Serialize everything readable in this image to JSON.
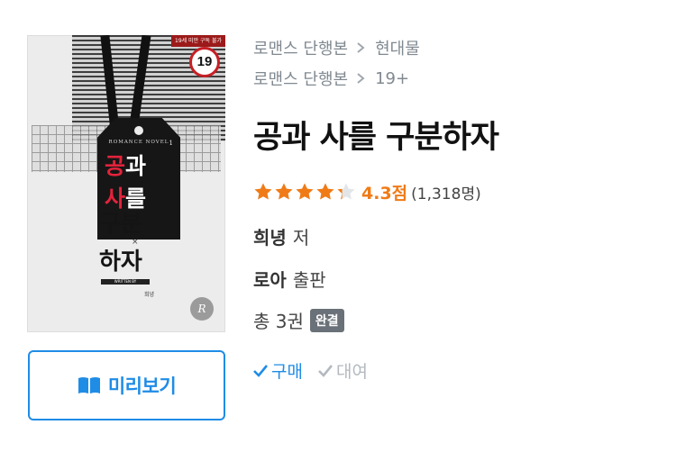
{
  "cover": {
    "age_banner": "19세 미만 구독 불가",
    "age_badge": "19",
    "tag_subtitle": "ROMANCE NOVEL",
    "tag_number": "1",
    "title_line1_a": "공",
    "title_line1_b": "과",
    "title_line2_a": "사",
    "title_line2_b": "를",
    "title_line3": "구분",
    "title_line4": "하자",
    "multiply": "×",
    "written_by": "WRITTEN BY",
    "author": "희녕"
  },
  "preview_button": {
    "label": "미리보기",
    "icon": "book-open-icon"
  },
  "breadcrumbs": [
    {
      "category": "로맨스 단행본",
      "sub": "현대물"
    },
    {
      "category": "로맨스 단행본",
      "sub": "19+"
    }
  ],
  "book": {
    "title": "공과 사를 구분하자"
  },
  "rating": {
    "score": "4.3점",
    "count": "(1,318명)",
    "stars_value": 4.3,
    "stars_max": 5
  },
  "author": {
    "name": "희녕",
    "role": "저"
  },
  "publisher": {
    "name": "로아",
    "role": "출판"
  },
  "volumes": {
    "text": "총 3권",
    "status": "완결"
  },
  "purchase_options": {
    "buy": "구매",
    "rent": "대여"
  },
  "colors": {
    "accent": "#1f8ce6",
    "star": "#f07b16",
    "muted": "#808991",
    "badge": "#6a7178"
  }
}
